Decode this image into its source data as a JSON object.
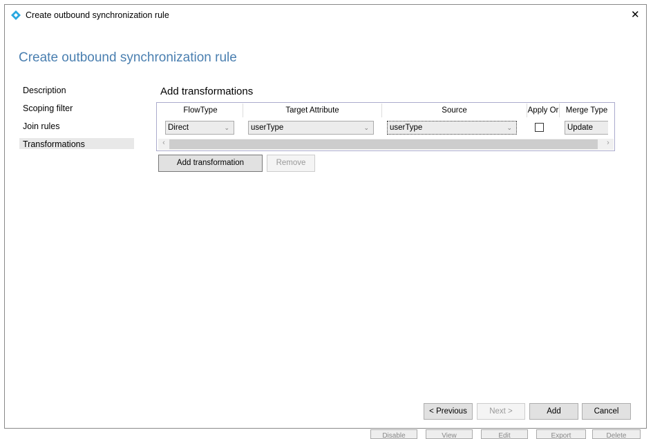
{
  "window": {
    "title": "Create outbound synchronization rule",
    "close": "✕"
  },
  "page_title": "Create outbound synchronization rule",
  "nav": [
    {
      "label": "Description"
    },
    {
      "label": "Scoping filter"
    },
    {
      "label": "Join rules"
    },
    {
      "label": "Transformations"
    }
  ],
  "section_title": "Add transformations",
  "grid": {
    "columns": [
      "FlowType",
      "Target Attribute",
      "Source",
      "Apply Or",
      "Merge Type"
    ],
    "row": {
      "flow_type": "Direct",
      "target_attribute": "userType",
      "source": "userType",
      "apply_once": false,
      "merge_type": "Update"
    }
  },
  "buttons": {
    "add_transformation": "Add transformation",
    "remove": "Remove",
    "previous": "< Previous",
    "next": "Next >",
    "add": "Add",
    "cancel": "Cancel"
  },
  "background_buttons": [
    "Disable",
    "View",
    "Edit",
    "Export",
    "Delete"
  ]
}
